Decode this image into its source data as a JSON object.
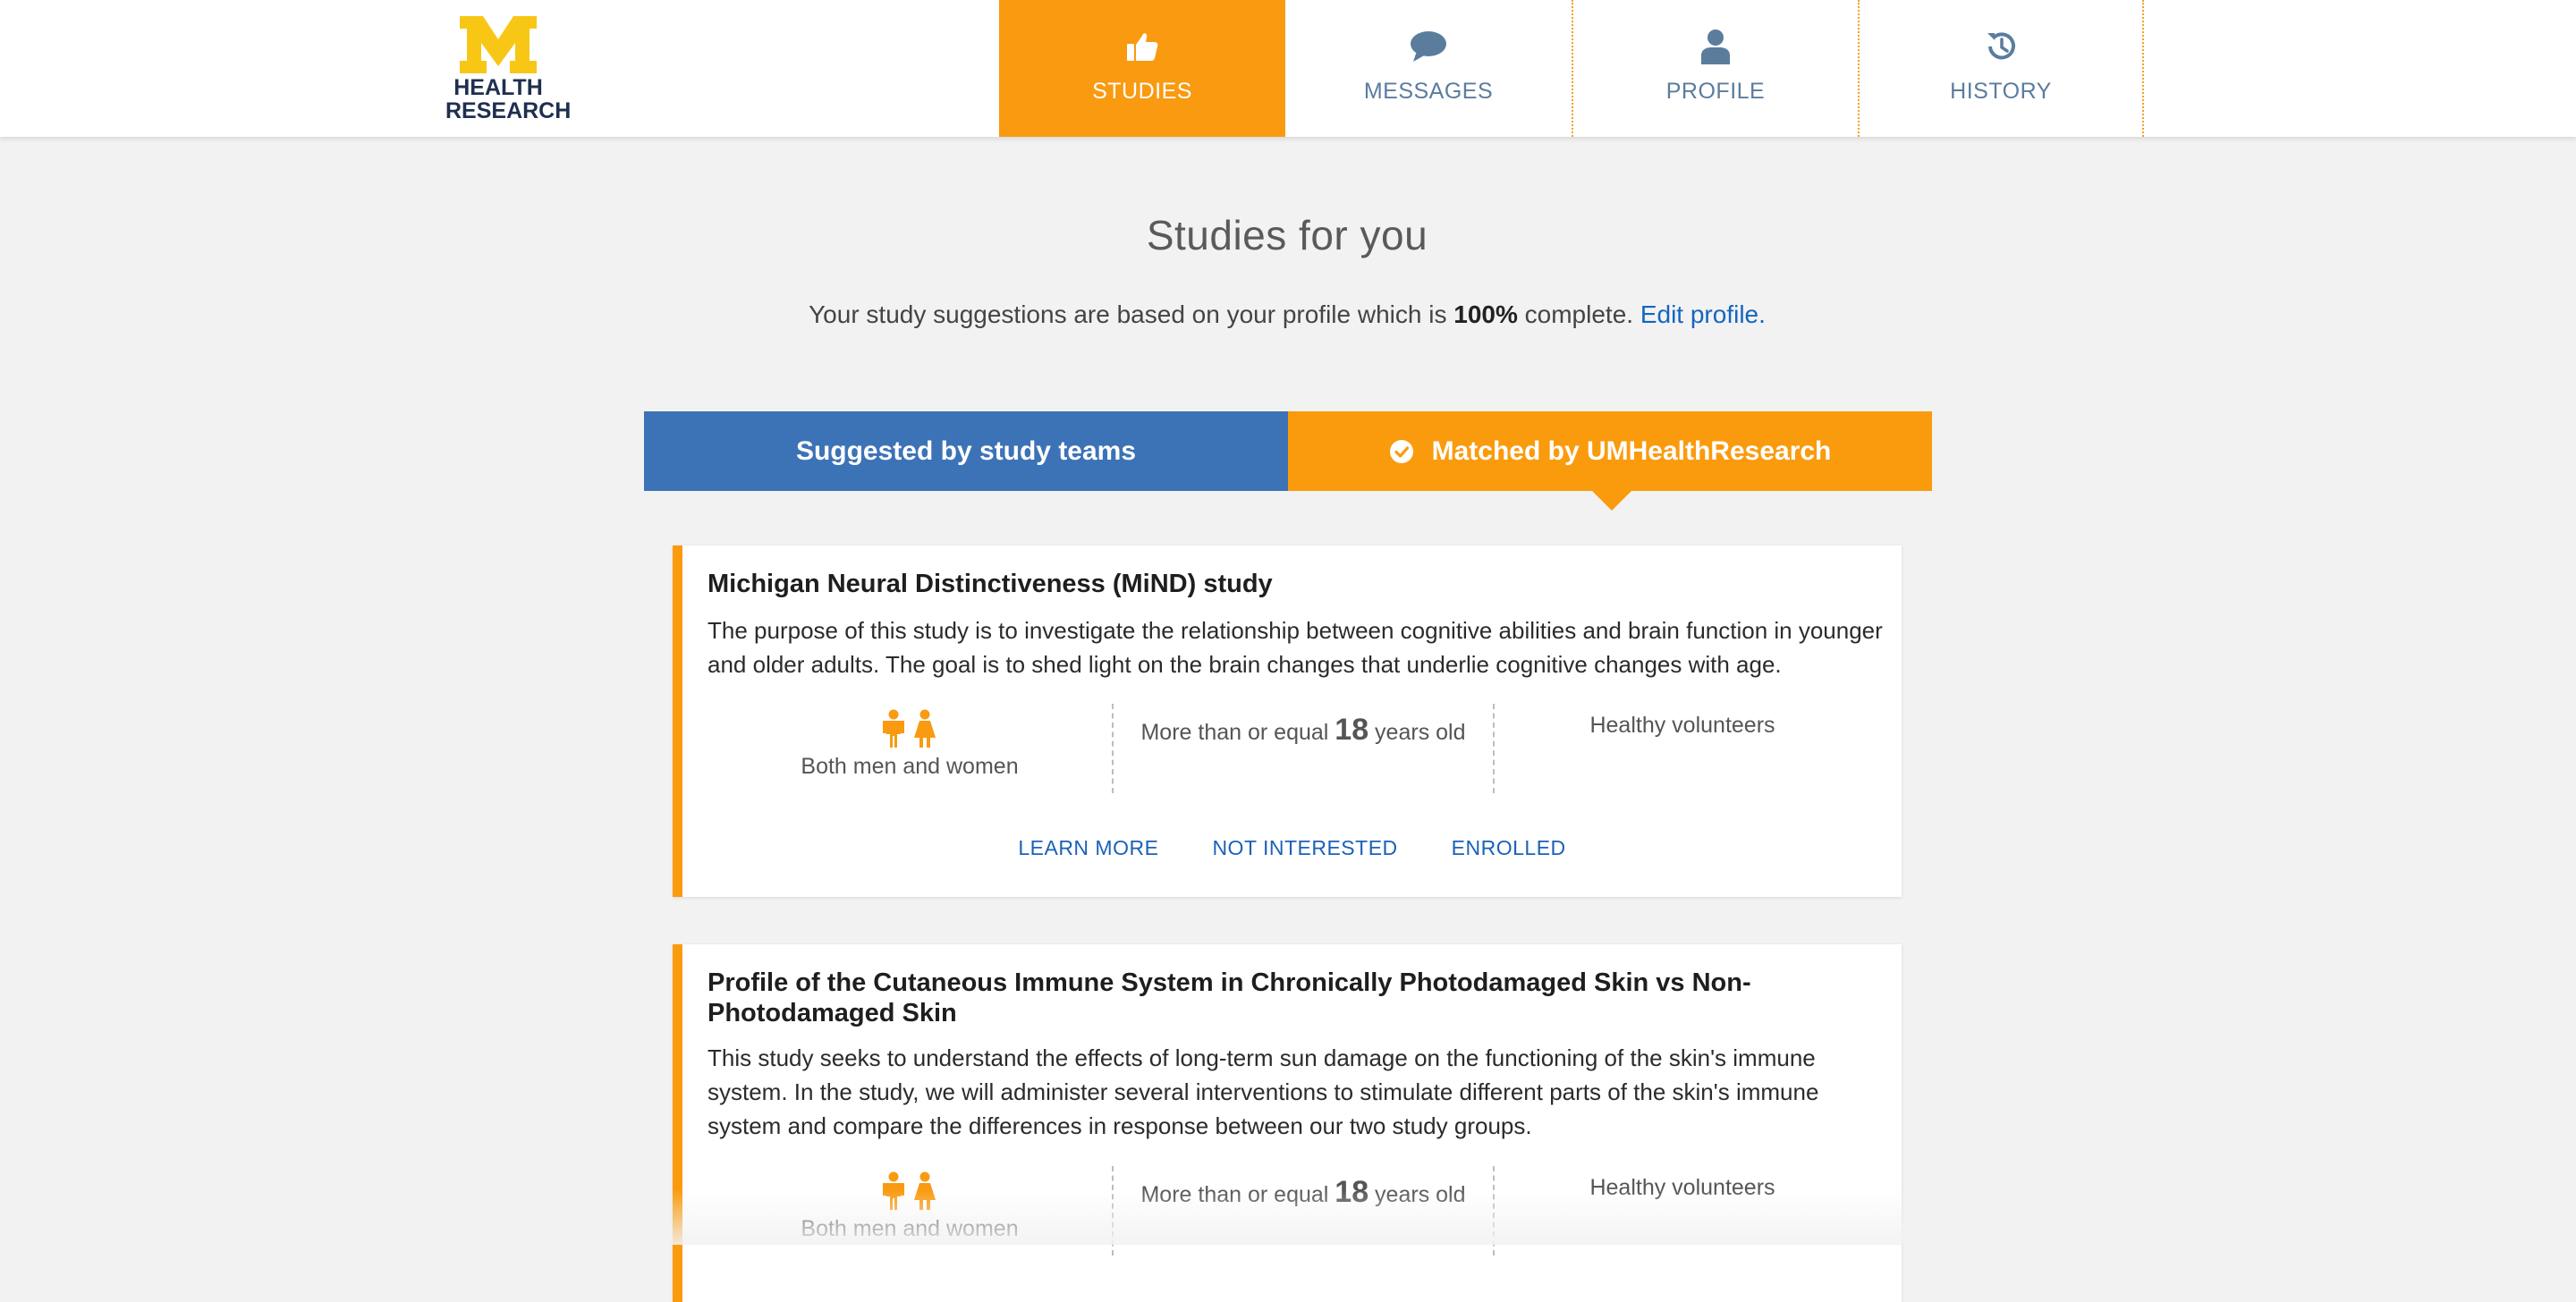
{
  "brand": {
    "logo_line1": "HEALTH",
    "logo_line2": "RESEARCH"
  },
  "nav": [
    {
      "label": "STUDIES",
      "icon": "thumbs-up-icon",
      "active": true
    },
    {
      "label": "MESSAGES",
      "icon": "chat-bubble-icon",
      "active": false
    },
    {
      "label": "PROFILE",
      "icon": "person-icon",
      "active": false
    },
    {
      "label": "HISTORY",
      "icon": "history-clock-icon",
      "active": false
    }
  ],
  "page": {
    "title": "Studies for you",
    "subtitle_prefix": "Your study suggestions are based on your profile which is ",
    "subtitle_percent": "100%",
    "subtitle_middle": " complete. ",
    "edit_link": "Edit profile",
    "subtitle_suffix": "."
  },
  "tabs": {
    "suggested": "Suggested by study teams",
    "matched": "Matched by UMHealthResearch"
  },
  "studies": [
    {
      "title": "Michigan Neural Distinctiveness (MiND) study",
      "description": "The purpose of this study is to investigate the relationship between cognitive abilities and brain function in younger and older adults. The goal is to shed light on the brain changes that underlie cognitive changes with age.",
      "gender": "Both men and women",
      "age_prefix": "More than or equal ",
      "age_value": "18",
      "age_suffix": " years old",
      "volunteer_type": "Healthy volunteers",
      "actions": [
        "LEARN MORE",
        "NOT INTERESTED",
        "ENROLLED"
      ]
    },
    {
      "title": "Profile of the Cutaneous Immune System in Chronically Photodamaged Skin vs Non-Photodamaged Skin",
      "description": "This study seeks to understand the effects of long-term sun damage on the functioning of the skin's immune system. In the study, we will administer several interventions to stimulate different parts of the skin's immune system and compare the differences in response between our two study groups.",
      "gender": "Both men and women",
      "age_prefix": "More than or equal ",
      "age_value": "18",
      "age_suffix": " years old",
      "volunteer_type": "Healthy volunteers"
    }
  ],
  "colors": {
    "accent_orange": "#fa9b0e",
    "tab_blue": "#3c73b6",
    "logo_yellow": "#f8c716",
    "logo_navy": "#1f2f4f",
    "link_blue": "#1a62b8"
  }
}
